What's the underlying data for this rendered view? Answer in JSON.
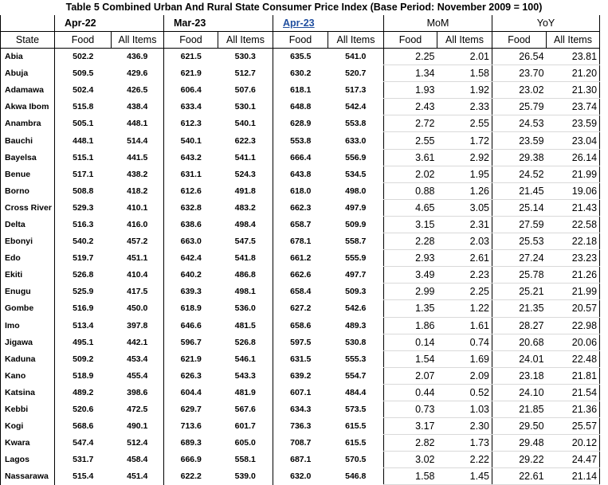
{
  "title": "Table 5 Combined Urban And Rural State Consumer Price Index (Base Period:  November  2009 = 100)",
  "periods": [
    "Apr-22",
    "Mar-23",
    "Apr-23",
    "MoM",
    "YoY"
  ],
  "columns": [
    "State",
    "Food",
    "All Items",
    "Food",
    "All Items",
    "Food",
    "All Items",
    "Food",
    "All Items",
    "Food",
    "All Items"
  ],
  "rows": [
    [
      "Abia",
      "502.2",
      "436.9",
      "621.5",
      "530.3",
      "635.5",
      "541.0",
      "2.25",
      "2.01",
      "26.54",
      "23.81"
    ],
    [
      "Abuja",
      "509.5",
      "429.6",
      "621.9",
      "512.7",
      "630.2",
      "520.7",
      "1.34",
      "1.58",
      "23.70",
      "21.20"
    ],
    [
      "Adamawa",
      "502.4",
      "426.5",
      "606.4",
      "507.6",
      "618.1",
      "517.3",
      "1.93",
      "1.92",
      "23.02",
      "21.30"
    ],
    [
      "Akwa Ibom",
      "515.8",
      "438.4",
      "633.4",
      "530.1",
      "648.8",
      "542.4",
      "2.43",
      "2.33",
      "25.79",
      "23.74"
    ],
    [
      "Anambra",
      "505.1",
      "448.1",
      "612.3",
      "540.1",
      "628.9",
      "553.8",
      "2.72",
      "2.55",
      "24.53",
      "23.59"
    ],
    [
      "Bauchi",
      "448.1",
      "514.4",
      "540.1",
      "622.3",
      "553.8",
      "633.0",
      "2.55",
      "1.72",
      "23.59",
      "23.04"
    ],
    [
      "Bayelsa",
      "515.1",
      "441.5",
      "643.2",
      "541.1",
      "666.4",
      "556.9",
      "3.61",
      "2.92",
      "29.38",
      "26.14"
    ],
    [
      "Benue",
      "517.1",
      "438.2",
      "631.1",
      "524.3",
      "643.8",
      "534.5",
      "2.02",
      "1.95",
      "24.52",
      "21.99"
    ],
    [
      "Borno",
      "508.8",
      "418.2",
      "612.6",
      "491.8",
      "618.0",
      "498.0",
      "0.88",
      "1.26",
      "21.45",
      "19.06"
    ],
    [
      "Cross River",
      "529.3",
      "410.1",
      "632.8",
      "483.2",
      "662.3",
      "497.9",
      "4.65",
      "3.05",
      "25.14",
      "21.43"
    ],
    [
      "Delta",
      "516.3",
      "416.0",
      "638.6",
      "498.4",
      "658.7",
      "509.9",
      "3.15",
      "2.31",
      "27.59",
      "22.58"
    ],
    [
      "Ebonyi",
      "540.2",
      "457.2",
      "663.0",
      "547.5",
      "678.1",
      "558.7",
      "2.28",
      "2.03",
      "25.53",
      "22.18"
    ],
    [
      "Edo",
      "519.7",
      "451.1",
      "642.4",
      "541.8",
      "661.2",
      "555.9",
      "2.93",
      "2.61",
      "27.24",
      "23.23"
    ],
    [
      "Ekiti",
      "526.8",
      "410.4",
      "640.2",
      "486.8",
      "662.6",
      "497.7",
      "3.49",
      "2.23",
      "25.78",
      "21.26"
    ],
    [
      "Enugu",
      "525.9",
      "417.5",
      "639.3",
      "498.1",
      "658.4",
      "509.3",
      "2.99",
      "2.25",
      "25.21",
      "21.99"
    ],
    [
      "Gombe",
      "516.9",
      "450.0",
      "618.9",
      "536.0",
      "627.2",
      "542.6",
      "1.35",
      "1.22",
      "21.35",
      "20.57"
    ],
    [
      "Imo",
      "513.4",
      "397.8",
      "646.6",
      "481.5",
      "658.6",
      "489.3",
      "1.86",
      "1.61",
      "28.27",
      "22.98"
    ],
    [
      "Jigawa",
      "495.1",
      "442.1",
      "596.7",
      "526.8",
      "597.5",
      "530.8",
      "0.14",
      "0.74",
      "20.68",
      "20.06"
    ],
    [
      "Kaduna",
      "509.2",
      "453.4",
      "621.9",
      "546.1",
      "631.5",
      "555.3",
      "1.54",
      "1.69",
      "24.01",
      "22.48"
    ],
    [
      "Kano",
      "518.9",
      "455.4",
      "626.3",
      "543.3",
      "639.2",
      "554.7",
      "2.07",
      "2.09",
      "23.18",
      "21.81"
    ],
    [
      "Katsina",
      "489.2",
      "398.6",
      "604.4",
      "481.9",
      "607.1",
      "484.4",
      "0.44",
      "0.52",
      "24.10",
      "21.54"
    ],
    [
      "Kebbi",
      "520.6",
      "472.5",
      "629.7",
      "567.6",
      "634.3",
      "573.5",
      "0.73",
      "1.03",
      "21.85",
      "21.36"
    ],
    [
      "Kogi",
      "568.6",
      "490.1",
      "713.6",
      "601.7",
      "736.3",
      "615.5",
      "3.17",
      "2.30",
      "29.50",
      "25.57"
    ],
    [
      "Kwara",
      "547.4",
      "512.4",
      "689.3",
      "605.0",
      "708.7",
      "615.5",
      "2.82",
      "1.73",
      "29.48",
      "20.12"
    ],
    [
      "Lagos",
      "531.7",
      "458.4",
      "666.9",
      "558.1",
      "687.1",
      "570.5",
      "3.02",
      "2.22",
      "29.22",
      "24.47"
    ],
    [
      "Nassarawa",
      "515.4",
      "451.4",
      "622.2",
      "539.0",
      "632.0",
      "546.8",
      "1.58",
      "1.45",
      "22.61",
      "21.14"
    ]
  ]
}
